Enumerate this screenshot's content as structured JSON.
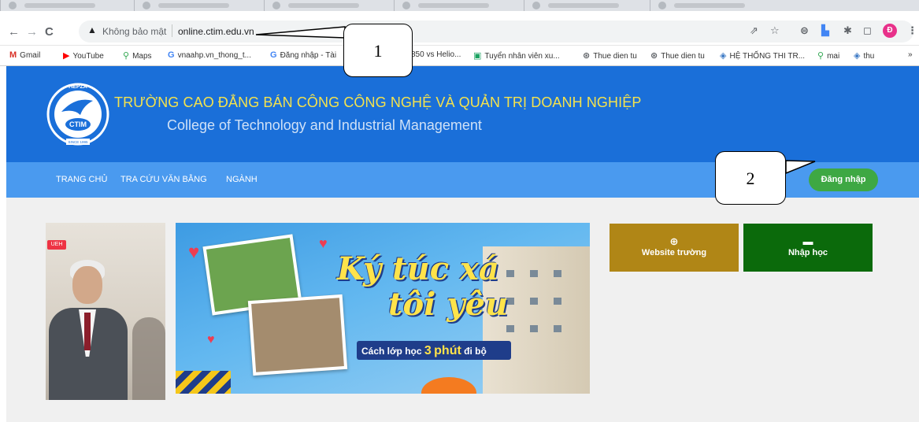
{
  "browser": {
    "omnibox": {
      "security_warning": "Không bảo mật",
      "url": "online.ctim.edu.vn"
    },
    "nav_icons": {
      "back": "←",
      "forward": "→",
      "reload": "C",
      "warning": "▲"
    },
    "toolbar_icons": [
      "share-icon",
      "star-icon",
      "extension-icon",
      "translate-icon",
      "puzzle-icon",
      "sidepanel-icon"
    ],
    "profile_initial": "Đ",
    "bookmarks": [
      {
        "icon": "gmail-icon",
        "glyph": "M",
        "color": "#d93025",
        "label": "Gmail"
      },
      {
        "icon": "youtube-icon",
        "glyph": "▶",
        "color": "#ff0000",
        "label": "YouTube"
      },
      {
        "icon": "maps-icon",
        "glyph": "⚲",
        "color": "#34a853",
        "label": "Maps"
      },
      {
        "icon": "google-icon",
        "glyph": "G",
        "color": "#4285f4",
        "label": "vnaahp.vn_thong_t..."
      },
      {
        "icon": "google-icon",
        "glyph": "G",
        "color": "#4285f4",
        "label": "Đăng nhập - Tài"
      },
      {
        "icon": "generic-icon",
        "glyph": "",
        "color": "#888888",
        "label": "850 vs Helio..."
      },
      {
        "icon": "sheet-icon",
        "glyph": "▣",
        "color": "#1aa260",
        "label": "Tuyển nhân viên xu..."
      },
      {
        "icon": "globe-icon",
        "glyph": "⊛",
        "color": "#5f6368",
        "label": "Thue dien tu"
      },
      {
        "icon": "globe-icon",
        "glyph": "⊛",
        "color": "#5f6368",
        "label": "Thue dien tu"
      },
      {
        "icon": "site-icon",
        "glyph": "◈",
        "color": "#3b78c4",
        "label": "HỆ THỐNG THI TR..."
      },
      {
        "icon": "maps-icon",
        "glyph": "⚲",
        "color": "#34a853",
        "label": "mai"
      },
      {
        "icon": "site-icon",
        "glyph": "◈",
        "color": "#3b78c4",
        "label": "thu"
      }
    ],
    "more_bookmarks": "»"
  },
  "site": {
    "logo": {
      "top_text": "HEPZA",
      "mid_text": "CTIM",
      "bottom_text": "SINCE 1995"
    },
    "title_vi": "TRƯỜNG CAO ĐẲNG BÁN CÔNG CÔNG NGHỆ VÀ QUẢN TRỊ DOANH NGHIỆP",
    "title_en": "College of Technology and Industrial Management",
    "nav": [
      "TRANG CHỦ",
      "TRA CỨU VĂN BẰNG",
      "NGÀNH"
    ],
    "login_label": "Đăng nhập",
    "tiles": [
      {
        "icon": "globe-icon",
        "glyph": "⊕",
        "label": "Website trường"
      },
      {
        "icon": "calendar-icon",
        "glyph": "▬",
        "label": "Nhập học"
      }
    ],
    "banner": {
      "slogan_line1": "Ký túc xá",
      "slogan_line2": "tôi yêu",
      "tag_prefix": "Cách lớp học",
      "tag_number": "3",
      "tag_unit": "phút",
      "tag_suffix": "đi bộ"
    },
    "photo_badge": "UEH"
  },
  "callouts": [
    "1",
    "2"
  ],
  "colors": {
    "header_blue": "#1a6fd9",
    "nav_blue": "#4a9aef",
    "title_yellow": "#f4e24d",
    "login_green": "#3ea843",
    "tile_gold": "#b08616",
    "tile_green": "#0b6a0b"
  }
}
